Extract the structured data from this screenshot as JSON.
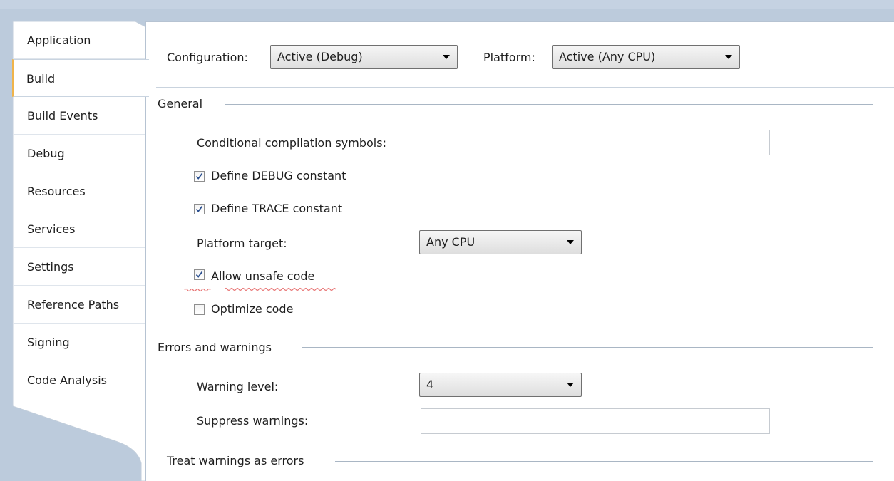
{
  "sidebar": {
    "tabs": [
      {
        "label": "Application"
      },
      {
        "label": "Build"
      },
      {
        "label": "Build Events"
      },
      {
        "label": "Debug"
      },
      {
        "label": "Resources"
      },
      {
        "label": "Services"
      },
      {
        "label": "Settings"
      },
      {
        "label": "Reference Paths"
      },
      {
        "label": "Signing"
      },
      {
        "label": "Code Analysis"
      }
    ],
    "active_tab": "Build"
  },
  "header": {
    "configuration_label": "Configuration:",
    "configuration_value": "Active (Debug)",
    "platform_label": "Platform:",
    "platform_value": "Active (Any CPU)"
  },
  "general": {
    "title": "General",
    "symbols_label": "Conditional compilation symbols:",
    "symbols_value": "",
    "define_debug_label": "Define DEBUG constant",
    "define_debug_checked": true,
    "define_trace_label": "Define TRACE constant",
    "define_trace_checked": true,
    "platform_target_label": "Platform target:",
    "platform_target_value": "Any CPU",
    "allow_unsafe_label": "Allow unsafe code",
    "allow_unsafe_checked": true,
    "optimize_label": "Optimize code",
    "optimize_checked": false
  },
  "errors": {
    "title": "Errors and warnings",
    "warning_level_label": "Warning level:",
    "warning_level_value": "4",
    "suppress_label": "Suppress warnings:",
    "suppress_value": ""
  },
  "treat_warnings": {
    "title": "Treat warnings as errors"
  },
  "colors": {
    "accent_tab_border": "#f0b44a",
    "squiggle": "#e04a4a",
    "background": "#bccbdc"
  }
}
